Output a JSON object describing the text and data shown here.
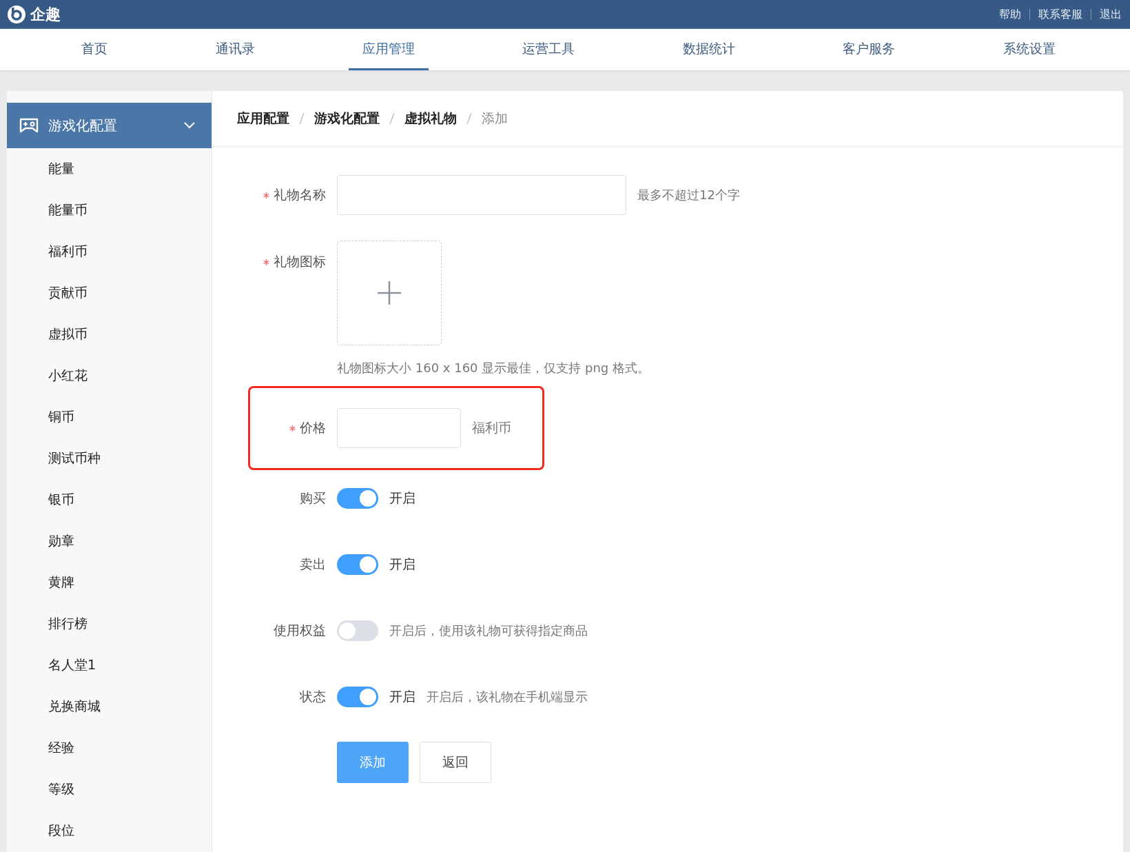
{
  "header": {
    "logo_text": "企趣",
    "links": [
      "帮助",
      "联系客服",
      "退出"
    ]
  },
  "nav": [
    {
      "label": "首页",
      "selected": false
    },
    {
      "label": "通讯录",
      "selected": false
    },
    {
      "label": "应用管理",
      "selected": true
    },
    {
      "label": "运营工具",
      "selected": false
    },
    {
      "label": "数据统计",
      "selected": false
    },
    {
      "label": "客户服务",
      "selected": false
    },
    {
      "label": "系统设置",
      "selected": false
    }
  ],
  "sidebar": {
    "group": {
      "label": "游戏化配置",
      "expanded": true,
      "items": [
        "能量",
        "能量币",
        "福利币",
        "贡献币",
        "虚拟币",
        "小红花",
        "铜币",
        "测试币种",
        "银币",
        "勋章",
        "黄牌",
        "排行榜",
        "名人堂1",
        "兑换商城",
        "经验",
        "等级",
        "段位"
      ]
    }
  },
  "breadcrumb": [
    {
      "label": "应用配置",
      "current": false
    },
    {
      "label": "游戏化配置",
      "current": false
    },
    {
      "label": "虚拟礼物",
      "current": false
    },
    {
      "label": "添加",
      "current": true
    }
  ],
  "form": [
    {
      "kind": "text",
      "label": "礼物名称",
      "required": true,
      "highlighted": false,
      "suffix": "最多不超过12个字"
    },
    {
      "kind": "upload",
      "label": "礼物图标",
      "required": true,
      "highlighted": false,
      "hint": "礼物图标大小 160 x 160 显示最佳，仅支持 png 格式。"
    },
    {
      "kind": "price",
      "label": "价格",
      "required": true,
      "highlighted": true,
      "suffix": "福利币"
    },
    {
      "kind": "toggle",
      "label": "购买",
      "required": false,
      "highlighted": false,
      "on": true,
      "state_label": "开启"
    },
    {
      "kind": "toggle",
      "label": "卖出",
      "required": false,
      "highlighted": false,
      "on": true,
      "state_label": "开启"
    },
    {
      "kind": "toggle",
      "label": "使用权益",
      "required": false,
      "highlighted": false,
      "on": false,
      "note": "开启后，使用该礼物可获得指定商品"
    },
    {
      "kind": "toggle",
      "label": "状态",
      "required": false,
      "highlighted": false,
      "on": true,
      "state_label": "开启",
      "note": "开启后，该礼物在手机端显示"
    }
  ],
  "buttons": [
    {
      "label": "添加",
      "kind": "primary"
    },
    {
      "label": "返回",
      "kind": "default"
    }
  ]
}
